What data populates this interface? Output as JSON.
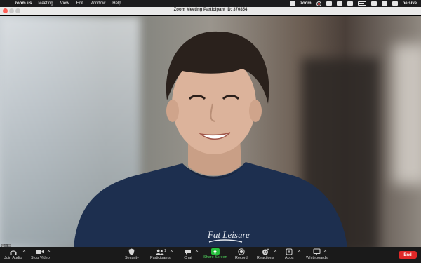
{
  "menubar": {
    "app": "zoom.us",
    "items": [
      "Meeting",
      "View",
      "Edit",
      "Window",
      "Help"
    ],
    "zoom_status": "zoom",
    "user": "pelsive"
  },
  "window": {
    "title": "Zoom Meeting Participant ID: 370854"
  },
  "video": {
    "shirt_text": "Fat Leisure",
    "name_tag": "東京 原"
  },
  "toolbar": {
    "join_audio": "Join Audio",
    "stop_video": "Stop Video",
    "security": "Security",
    "participants": "Participants",
    "participants_count": "1",
    "chat": "Chat",
    "share_screen": "Share Screen",
    "record": "Record",
    "reactions": "Reactions",
    "apps": "Apps",
    "whiteboards": "Whiteboards",
    "end": "End"
  },
  "colors": {
    "end_button": "#e02828",
    "share_green": "#27c13d",
    "close_traffic": "#ff5f57"
  }
}
